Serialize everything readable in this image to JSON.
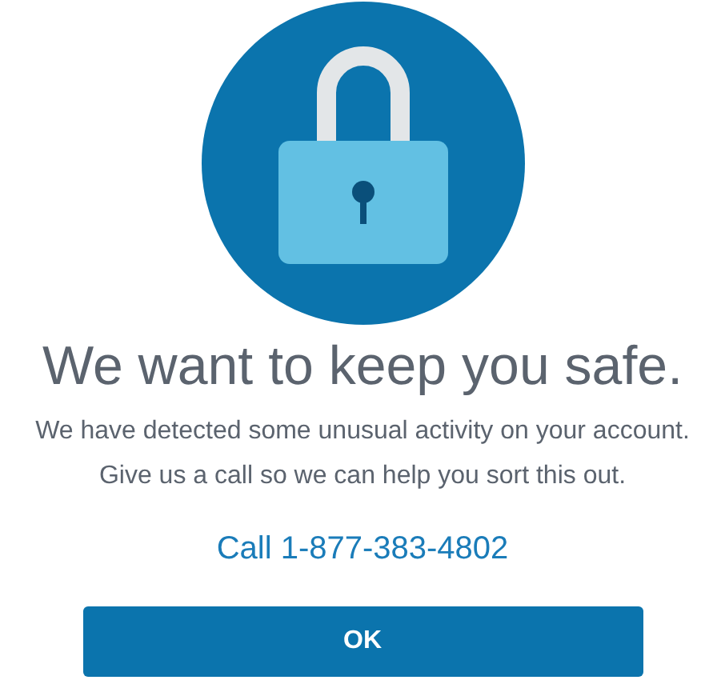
{
  "title": "We want to keep you safe.",
  "message": [
    "We have detected some unusual activity on your account.",
    "Give us a call so we can help you sort this out."
  ],
  "call_link": "Call 1-877-383-4802",
  "button": "OK"
}
